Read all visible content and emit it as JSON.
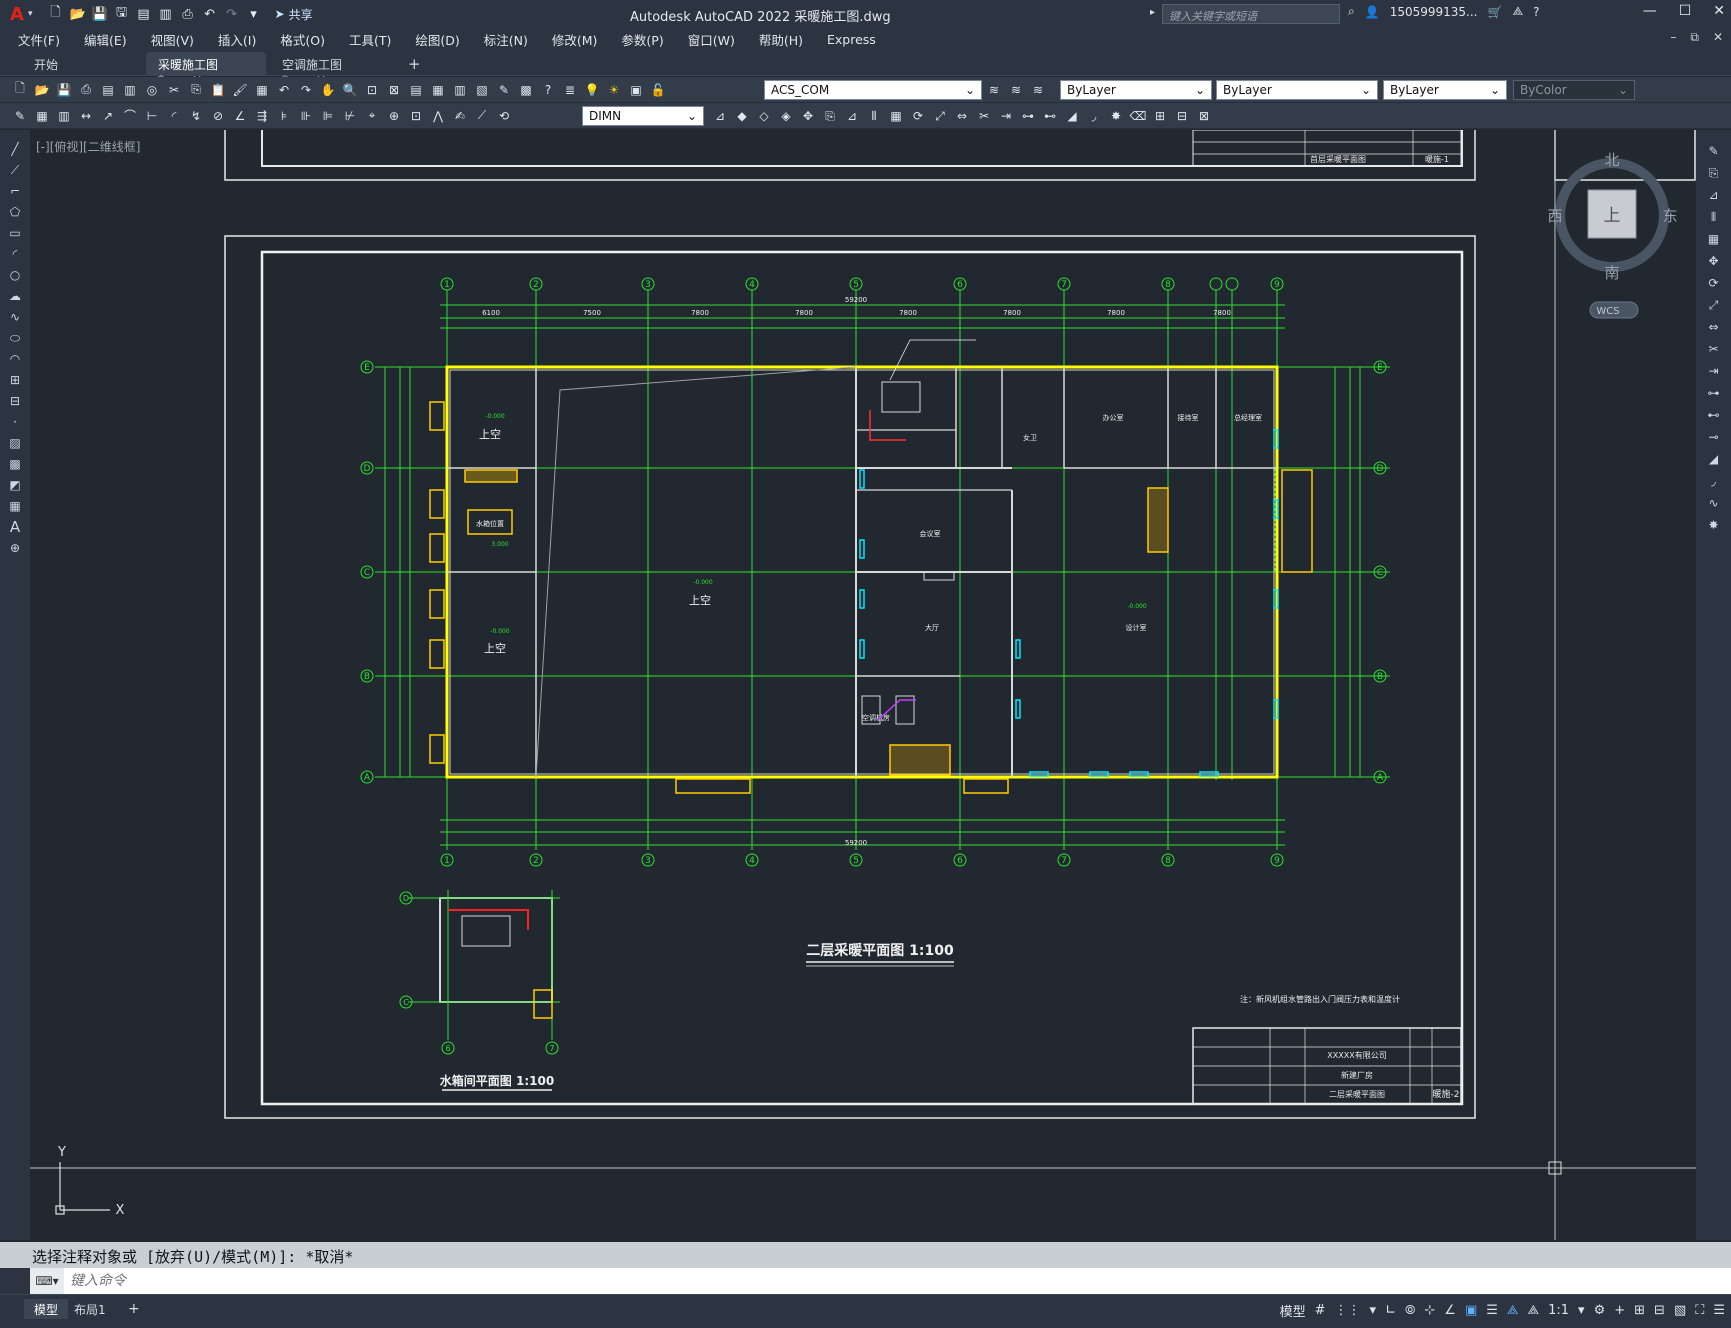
{
  "app": {
    "title": "Autodesk AutoCAD 2022    采暖施工图.dwg",
    "share_label": "共享",
    "search_placeholder": "键入关键字或短语",
    "user": "1505999135...",
    "brand_color": "#e2231a"
  },
  "menu": [
    "文件(F)",
    "编辑(E)",
    "视图(V)",
    "插入(I)",
    "格式(O)",
    "工具(T)",
    "绘图(D)",
    "标注(N)",
    "修改(M)",
    "参数(P)",
    "窗口(W)",
    "帮助(H)",
    "Express"
  ],
  "tabs": [
    {
      "label": "开始"
    },
    {
      "label": "采暖施工图*"
    },
    {
      "label": "空调施工图*"
    }
  ],
  "toolbar": {
    "layer_value": "ACS_COM",
    "color_value": "ByLayer",
    "linetype_value": "ByLayer",
    "lineweight_value": "ByLayer",
    "plotstyle_value": "ByColor",
    "dimstyle_value": "DIMN"
  },
  "viewport": {
    "label": "[-][俯视][二维线框]"
  },
  "viewcube": {
    "north": "北",
    "south": "南",
    "east": "东",
    "west": "西",
    "top": "上",
    "wcs": "WCS"
  },
  "drawing": {
    "main_title": "二层采暖平面图 1:100",
    "sub_title": "水箱间平面图 1:100",
    "note": "注：新风机组水管路出入门阀压力表和温度计",
    "grid_cols": [
      "1",
      "2",
      "3",
      "4",
      "5",
      "6",
      "7",
      "8",
      "9"
    ],
    "grid_rows": [
      "A",
      "B",
      "C",
      "D",
      "E"
    ],
    "top_dims": [
      "6100",
      "7500",
      "7800",
      "7800",
      "7800",
      "7800",
      "7800",
      "7800"
    ],
    "total_dim": "59200",
    "room_labels": {
      "void1": "上空",
      "void2": "上空",
      "void3": "上空",
      "tank": "水箱位置",
      "meeting": "会议室",
      "hall": "大厅",
      "office1": "办公室",
      "office2": "接待室",
      "office3": "总经理室",
      "design": "设计室",
      "ac": "空调机房",
      "water": "女卫",
      "elev1": "-0.000",
      "elev2": "-0.000",
      "elev3": "-0.000",
      "elev4": "-0.000",
      "elev5": "3.000"
    },
    "title_block": {
      "company": "XXXXX有限公司",
      "project": "新建厂房",
      "sheet_name": "二层采暖平面图",
      "sheet_no": "暖施-2",
      "prev_sheet_name": "首层采暖平面图",
      "prev_sheet_no": "暖施-1"
    }
  },
  "command": {
    "history": "选择注释对象或 [放弃(U)/模式(M)]: *取消*",
    "placeholder": "键入命令"
  },
  "layouts": [
    "模型",
    "布局1"
  ],
  "status": {
    "model_label": "模型",
    "scale": "1:1"
  }
}
